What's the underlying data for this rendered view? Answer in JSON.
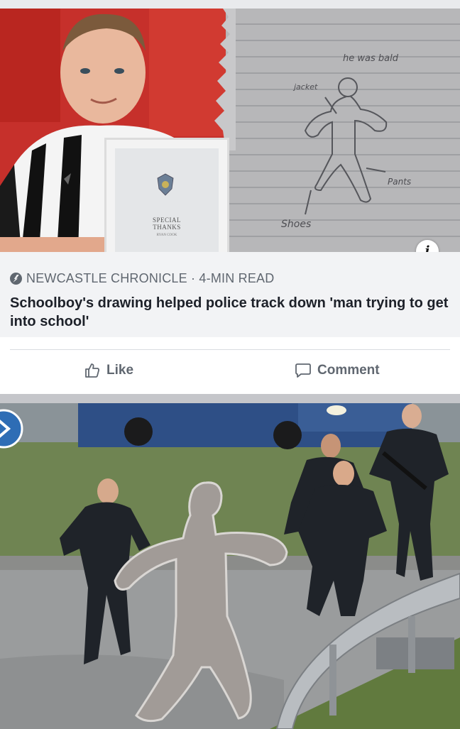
{
  "post": {
    "source": "NEWCASTLE CHRONICLE · 4-MIN READ",
    "headline": "Schoolboy's drawing helped police track down 'man trying to get into school'",
    "info_label": "i"
  },
  "certificate": {
    "title_line1": "SPECIAL",
    "title_line2": "THANKS",
    "name_line": "RYAN COOK"
  },
  "drawing_labels": {
    "top_note": "he was bald",
    "jacket": "jacket",
    "pants": "Pants",
    "shoes": "Shoes"
  },
  "actions": {
    "like_label": "Like",
    "comment_label": "Comment"
  },
  "icons": {
    "source": "lightning-icon",
    "info": "info-icon",
    "like": "thumbs-up-icon",
    "comment": "speech-bubble-icon"
  },
  "colors": {
    "meta_background": "#f2f3f5",
    "meta_text": "#606770",
    "headline_text": "#1d2129"
  }
}
